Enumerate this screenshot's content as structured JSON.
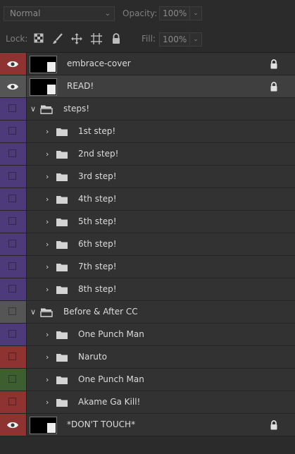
{
  "toolbar": {
    "blend_mode": "Normal",
    "opacity_label": "Opacity:",
    "opacity_value": "100%",
    "lock_label": "Lock:",
    "fill_label": "Fill:",
    "fill_value": "100%"
  },
  "colors": {
    "red": "#8e3232",
    "violet": "#4c3a7a",
    "gray": "#555555",
    "green": "#3d5e30"
  },
  "layers": [
    {
      "name": "embrace-cover",
      "type": "layer",
      "visible": true,
      "color": "red",
      "locked": true
    },
    {
      "name": "READ!",
      "type": "layer",
      "visible": true,
      "color": "gray",
      "locked": true,
      "selected": true
    },
    {
      "name": "steps!",
      "type": "group",
      "expanded": true,
      "color": "violet"
    },
    {
      "name": "1st step!",
      "type": "group",
      "expanded": false,
      "color": "violet",
      "indent": 1
    },
    {
      "name": "2nd step!",
      "type": "group",
      "expanded": false,
      "color": "violet",
      "indent": 1
    },
    {
      "name": "3rd step!",
      "type": "group",
      "expanded": false,
      "color": "violet",
      "indent": 1
    },
    {
      "name": "4th step!",
      "type": "group",
      "expanded": false,
      "color": "violet",
      "indent": 1
    },
    {
      "name": "5th step!",
      "type": "group",
      "expanded": false,
      "color": "violet",
      "indent": 1
    },
    {
      "name": "6th step!",
      "type": "group",
      "expanded": false,
      "color": "violet",
      "indent": 1
    },
    {
      "name": "7th step!",
      "type": "group",
      "expanded": false,
      "color": "violet",
      "indent": 1
    },
    {
      "name": "8th step!",
      "type": "group",
      "expanded": false,
      "color": "violet",
      "indent": 1
    },
    {
      "name": "Before & After CC",
      "type": "group",
      "expanded": true,
      "color": "gray"
    },
    {
      "name": "One Punch Man",
      "type": "group",
      "expanded": false,
      "color": "violet",
      "indent": 1
    },
    {
      "name": "Naruto",
      "type": "group",
      "expanded": false,
      "color": "red",
      "indent": 1
    },
    {
      "name": "One Punch Man",
      "type": "group",
      "expanded": false,
      "color": "green",
      "indent": 1
    },
    {
      "name": "Akame Ga Kill!",
      "type": "group",
      "expanded": false,
      "color": "red",
      "indent": 1
    },
    {
      "name": "*DON'T TOUCH*",
      "type": "layer",
      "visible": true,
      "color": "red",
      "locked": true
    }
  ]
}
